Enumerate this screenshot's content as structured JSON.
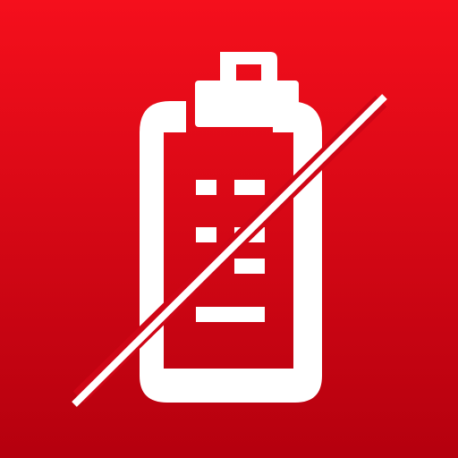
{
  "icon": {
    "name": "clipboard-checklist-disabled-icon",
    "colors": {
      "background_top": "#F50F1C",
      "background_bottom": "#B5000E",
      "glyph": "#FFFFFF"
    }
  }
}
